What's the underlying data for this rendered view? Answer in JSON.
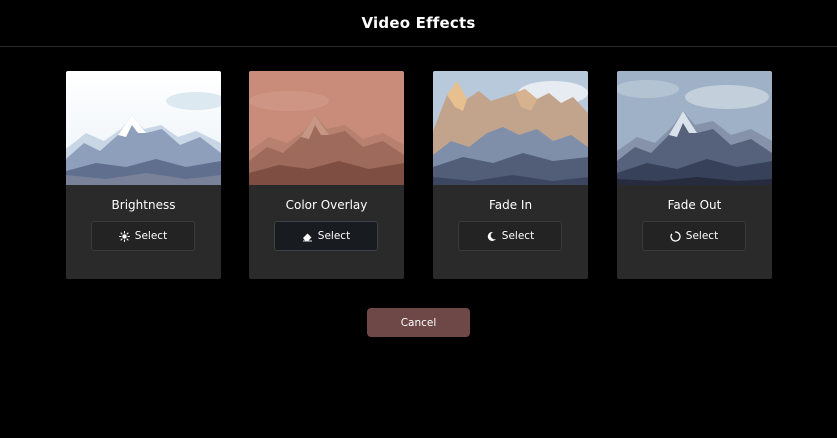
{
  "header": {
    "title": "Video Effects"
  },
  "effects": [
    {
      "label": "Brightness",
      "button_label": "Select",
      "icon": "sun-icon"
    },
    {
      "label": "Color Overlay",
      "button_label": "Select",
      "icon": "eraser-icon"
    },
    {
      "label": "Fade In",
      "button_label": "Select",
      "icon": "moon-icon"
    },
    {
      "label": "Fade Out",
      "button_label": "Select",
      "icon": "circle-notch-icon"
    }
  ],
  "footer": {
    "cancel_label": "Cancel"
  },
  "colors": {
    "cancel_bg": "#6e4747",
    "card_bg": "#2a2a2a",
    "page_bg": "#000000"
  }
}
